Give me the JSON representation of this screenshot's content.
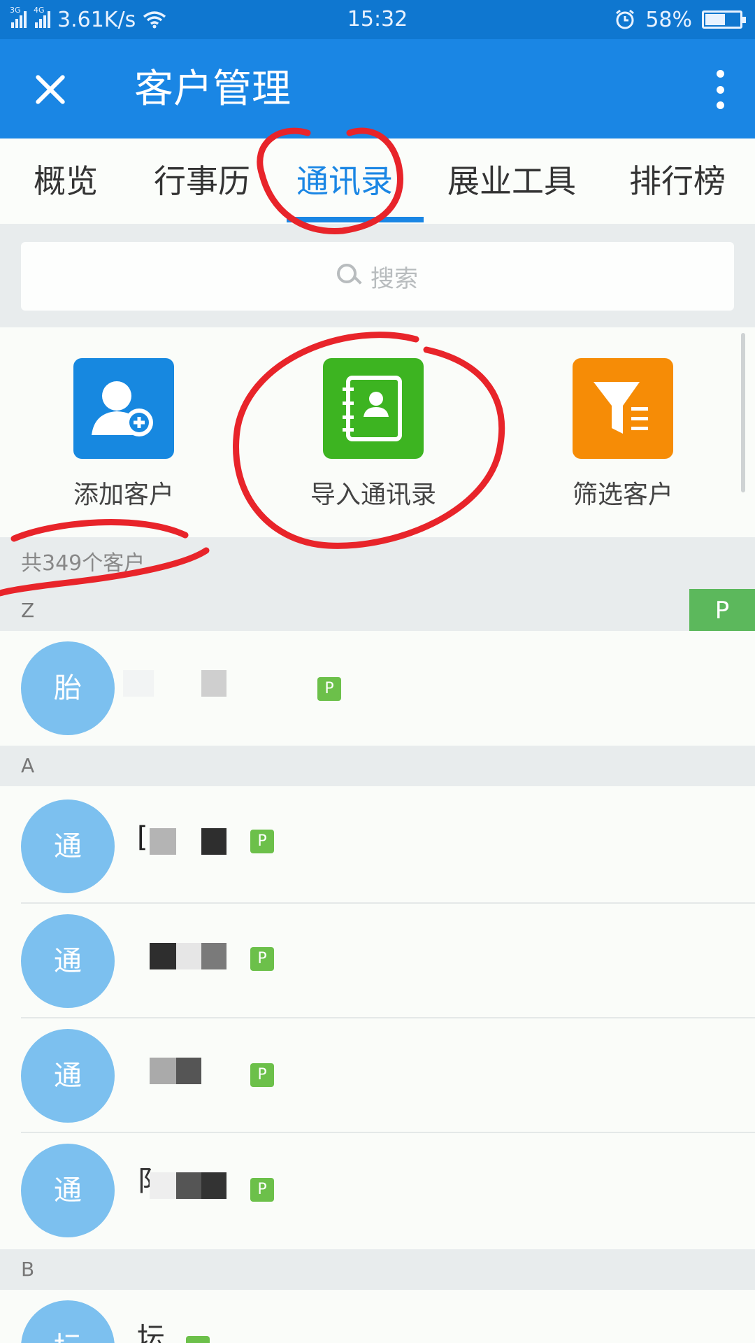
{
  "status_bar": {
    "network_1": "3G",
    "network_2": "4G",
    "speed": "3.61K/s",
    "time": "15:32",
    "battery": "58%",
    "battery_level": 0.58,
    "icons": [
      "signal-icon",
      "wifi-icon",
      "alarm-icon",
      "battery-icon"
    ]
  },
  "app_bar": {
    "title": "客户管理",
    "close_icon": "close-icon",
    "more_icon": "more-vertical-icon"
  },
  "tabs": [
    {
      "label": "概览",
      "active": false
    },
    {
      "label": "行事历",
      "active": false
    },
    {
      "label": "通讯录",
      "active": true
    },
    {
      "label": "展业工具",
      "active": false
    },
    {
      "label": "排行榜",
      "active": false
    }
  ],
  "search": {
    "placeholder": "搜索",
    "icon": "search-icon"
  },
  "quick_actions": [
    {
      "label": "添加客户",
      "icon": "add-user-icon",
      "color": "#1788e0"
    },
    {
      "label": "导入通讯录",
      "icon": "address-book-icon",
      "color": "#3db421"
    },
    {
      "label": "筛选客户",
      "icon": "filter-icon",
      "color": "#f68c06"
    }
  ],
  "customer_count": "共349个客户",
  "index_badge": "P",
  "sections": [
    {
      "letter": "Z",
      "contacts": [
        {
          "avatar": "胎",
          "name": "",
          "badge": "P"
        }
      ]
    },
    {
      "letter": "A",
      "contacts": [
        {
          "avatar": "通",
          "name": "[",
          "badge": "P"
        },
        {
          "avatar": "通",
          "name": "",
          "badge": "P"
        },
        {
          "avatar": "通",
          "name": "",
          "badge": "P"
        },
        {
          "avatar": "通",
          "name": "阝",
          "badge": "P"
        }
      ]
    },
    {
      "letter": "B",
      "contacts": [
        {
          "avatar": "坛",
          "name": "坛",
          "badge": ""
        }
      ]
    }
  ],
  "colors": {
    "primary": "#1a86e4",
    "status_bar": "#0f77d0",
    "avatar": "#7cc0ef",
    "badge_green": "#6cc04a",
    "annotation_red": "#e8242a"
  }
}
